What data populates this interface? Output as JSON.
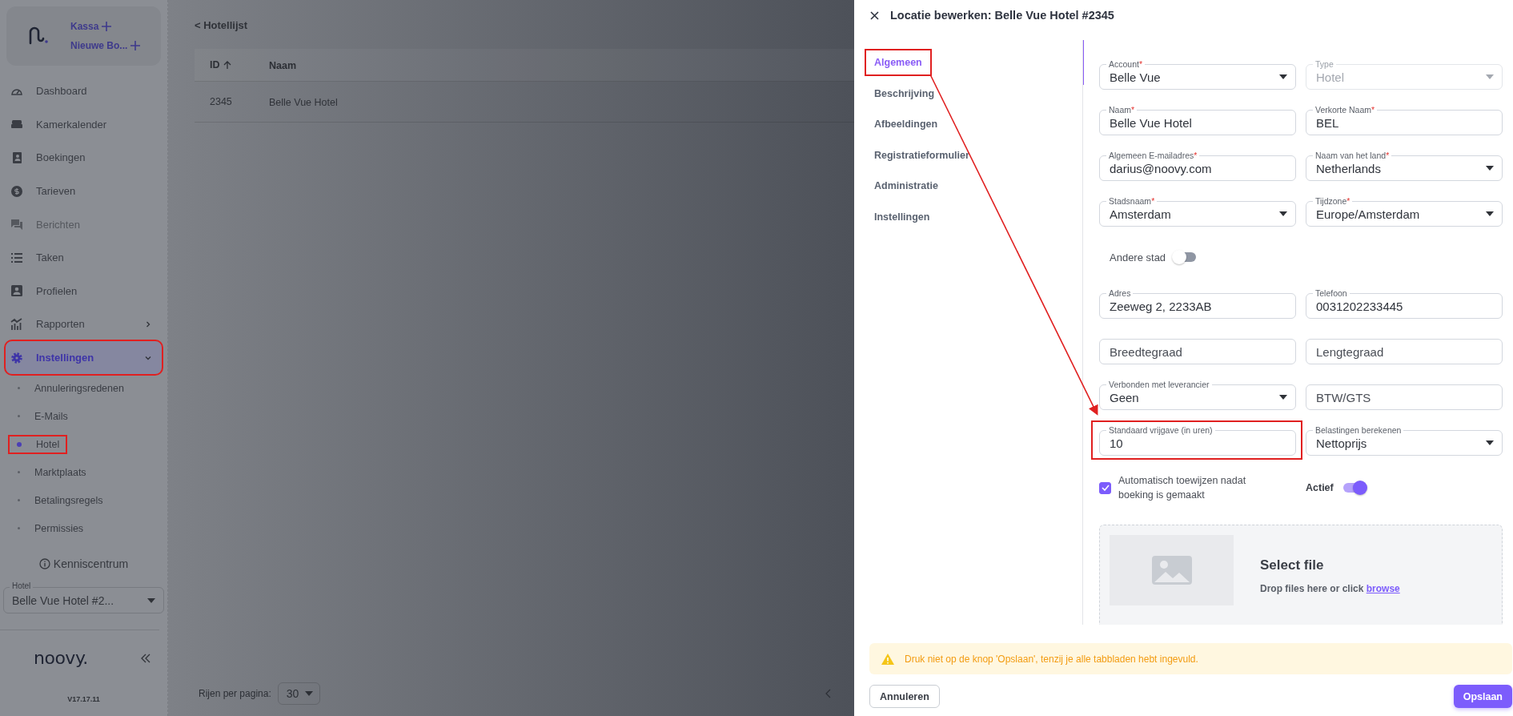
{
  "sidebar": {
    "quick_actions": [
      {
        "label": "Kassa"
      },
      {
        "label": "Nieuwe Bo..."
      }
    ],
    "menu": [
      {
        "kind": "link",
        "label": "Dashboard",
        "disabled": false,
        "selected": false,
        "highlighted": false
      },
      {
        "kind": "link",
        "label": "Kamerkalender",
        "disabled": false,
        "selected": false,
        "highlighted": false
      },
      {
        "kind": "link",
        "label": "Boekingen",
        "disabled": false,
        "selected": false,
        "highlighted": false
      },
      {
        "kind": "link",
        "label": "Tarieven",
        "disabled": false,
        "selected": false,
        "highlighted": false
      },
      {
        "kind": "link",
        "label": "Berichten",
        "disabled": true,
        "selected": false,
        "highlighted": false
      },
      {
        "kind": "link",
        "label": "Taken",
        "disabled": false,
        "selected": false,
        "highlighted": false
      },
      {
        "kind": "link",
        "label": "Profielen",
        "disabled": false,
        "selected": false,
        "highlighted": false
      },
      {
        "kind": "group",
        "label": "Rapporten",
        "disabled": false,
        "selected": false,
        "highlighted": false,
        "expanded": false
      },
      {
        "kind": "group",
        "label": "Instellingen",
        "disabled": false,
        "selected": true,
        "highlighted": true,
        "expanded": true,
        "children": [
          {
            "label": "Annuleringsredenen",
            "selected": false,
            "highlighted": false
          },
          {
            "label": "E-Mails",
            "selected": false,
            "highlighted": false
          },
          {
            "label": "Hotel",
            "selected": true,
            "highlighted": true
          },
          {
            "label": "Marktplaats",
            "selected": false,
            "highlighted": false
          },
          {
            "label": "Betalingsregels",
            "selected": false,
            "highlighted": false
          },
          {
            "label": "Permissies",
            "selected": false,
            "highlighted": false
          }
        ]
      }
    ],
    "help_link": "Kenniscentrum",
    "hotel_select": {
      "label": "Hotel",
      "value": "Belle Vue Hotel #2..."
    },
    "brand": "noovy.",
    "version": "V17.17.11"
  },
  "main": {
    "back_link": "< Hotellijst",
    "table": {
      "columns": [
        {
          "label": "ID",
          "sorted": true
        },
        {
          "label": "Naam",
          "sorted": false
        }
      ],
      "rows": [
        [
          "2345",
          "Belle Vue Hotel"
        ]
      ]
    },
    "pagination": {
      "label": "Rijen per pagina:",
      "value": "30"
    }
  },
  "drawer": {
    "title": "Locatie bewerken: Belle Vue Hotel #2345",
    "tabs": [
      {
        "label": "Algemeen",
        "selected": true,
        "highlighted": true
      },
      {
        "label": "Beschrijving",
        "selected": false,
        "highlighted": false
      },
      {
        "label": "Afbeeldingen",
        "selected": false,
        "highlighted": false
      },
      {
        "label": "Registratieformulier",
        "selected": false,
        "highlighted": false
      },
      {
        "label": "Administratie",
        "selected": false,
        "highlighted": false
      },
      {
        "label": "Instellingen",
        "selected": false,
        "highlighted": false
      }
    ],
    "fields_top": [
      {
        "kind": "select",
        "label": "Account",
        "required_mark": "*",
        "value": "Belle Vue",
        "disabled": false,
        "highlighted": false
      },
      {
        "kind": "select",
        "label": "Type",
        "value": "Hotel",
        "disabled": true,
        "highlighted": false
      },
      {
        "kind": "text",
        "label": "Naam",
        "required_mark": "*",
        "value": "Belle Vue Hotel",
        "disabled": false,
        "highlighted": false
      },
      {
        "kind": "text",
        "label": "Verkorte Naam",
        "required_mark": "*",
        "value": "BEL",
        "disabled": false,
        "highlighted": false
      },
      {
        "kind": "text",
        "label": "Algemeen E-mailadres",
        "required_mark": "*",
        "value": "darius@noovy.com",
        "disabled": false,
        "highlighted": false
      },
      {
        "kind": "select",
        "label": "Naam van het land",
        "required_mark": "*",
        "value": "Netherlands",
        "disabled": false,
        "highlighted": false
      },
      {
        "kind": "select",
        "label": "Stadsnaam",
        "required_mark": "*",
        "value": "Amsterdam",
        "disabled": false,
        "highlighted": false
      },
      {
        "kind": "select",
        "label": "Tijdzone",
        "required_mark": "*",
        "value": "Europe/Amsterdam",
        "disabled": false,
        "highlighted": false
      }
    ],
    "other_city": {
      "label": "Andere stad",
      "on": false
    },
    "fields_bottom": [
      {
        "kind": "text",
        "label": "Adres",
        "value": "Zeeweg 2, 2233AB",
        "disabled": false,
        "highlighted": false
      },
      {
        "kind": "text",
        "label": "Telefoon",
        "value": "0031202233445",
        "disabled": false,
        "highlighted": false
      },
      {
        "kind": "text",
        "placeholder": "Breedtegraad",
        "disabled": false,
        "highlighted": false
      },
      {
        "kind": "text",
        "placeholder": "Lengtegraad",
        "disabled": false,
        "highlighted": false
      },
      {
        "kind": "select",
        "label": "Verbonden met leverancier",
        "value": "Geen",
        "disabled": false,
        "highlighted": false
      },
      {
        "kind": "text",
        "placeholder": "BTW/GTS",
        "disabled": false,
        "highlighted": false
      },
      {
        "kind": "text",
        "label": "Standaard vrijgave (in uren)",
        "value": "10",
        "disabled": false,
        "highlighted": true
      },
      {
        "kind": "select",
        "label": "Belastingen berekenen",
        "value": "Nettoprijs",
        "disabled": false,
        "highlighted": false
      }
    ],
    "auto_assign": {
      "label": "Automatisch toewijzen nadat boeking is gemaakt",
      "checked": true
    },
    "active": {
      "label": "Actief",
      "on": true
    },
    "dropzone": {
      "title": "Select file",
      "text": "Drop files here or click",
      "link": "browse"
    },
    "warning": "Druk niet op de knop 'Opslaan', tenzij je alle tabbladen hebt ingevuld.",
    "buttons": {
      "cancel": "Annuleren",
      "save": "Opslaan"
    }
  }
}
